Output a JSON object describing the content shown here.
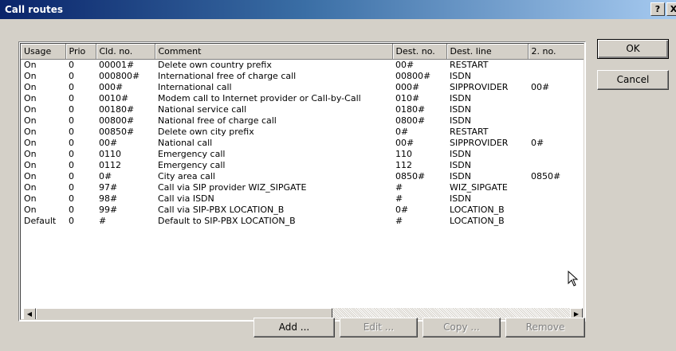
{
  "window": {
    "title": "Call routes",
    "help_label": "?",
    "close_label": "X"
  },
  "table": {
    "columns": [
      "Usage",
      "Prio",
      "Cld. no.",
      "Comment",
      "Dest. no.",
      "Dest. line",
      "2. no."
    ],
    "rows": [
      [
        "On",
        "0",
        "00001#",
        "Delete own country prefix",
        "00#",
        "RESTART",
        ""
      ],
      [
        "On",
        "0",
        "000800#",
        "International free of charge call",
        "00800#",
        "ISDN",
        ""
      ],
      [
        "On",
        "0",
        "000#",
        "International call",
        "000#",
        "SIPPROVIDER",
        "00#"
      ],
      [
        "On",
        "0",
        "0010#",
        "Modem call to Internet provider or Call-by-Call",
        "010#",
        "ISDN",
        ""
      ],
      [
        "On",
        "0",
        "00180#",
        "National service call",
        "0180#",
        "ISDN",
        ""
      ],
      [
        "On",
        "0",
        "00800#",
        "National free of charge call",
        "0800#",
        "ISDN",
        ""
      ],
      [
        "On",
        "0",
        "00850#",
        "Delete own city prefix",
        "0#",
        "RESTART",
        ""
      ],
      [
        "On",
        "0",
        "00#",
        "National call",
        "00#",
        "SIPPROVIDER",
        "0#"
      ],
      [
        "On",
        "0",
        "0110",
        "Emergency call",
        "110",
        "ISDN",
        ""
      ],
      [
        "On",
        "0",
        "0112",
        "Emergency call",
        "112",
        "ISDN",
        ""
      ],
      [
        "On",
        "0",
        "0#",
        "City area call",
        "0850#",
        "ISDN",
        "0850#"
      ],
      [
        "On",
        "0",
        "97#",
        "Call via SIP provider WIZ_SIPGATE",
        "#",
        "WIZ_SIPGATE",
        ""
      ],
      [
        "On",
        "0",
        "98#",
        "Call via ISDN",
        "#",
        "ISDN",
        ""
      ],
      [
        "On",
        "0",
        "99#",
        "Call via SIP-PBX LOCATION_B",
        "0#",
        "LOCATION_B",
        ""
      ],
      [
        "Default",
        "0",
        "#",
        "Default to SIP-PBX LOCATION_B",
        "#",
        "LOCATION_B",
        ""
      ]
    ]
  },
  "buttons": {
    "ok": "OK",
    "cancel": "Cancel",
    "add": "Add ...",
    "edit": "Edit ...",
    "copy": "Copy ...",
    "remove": "Remove"
  },
  "icons": {
    "scroll_left": "scroll-left-arrow-icon",
    "cursor": "mouse-pointer-icon"
  }
}
